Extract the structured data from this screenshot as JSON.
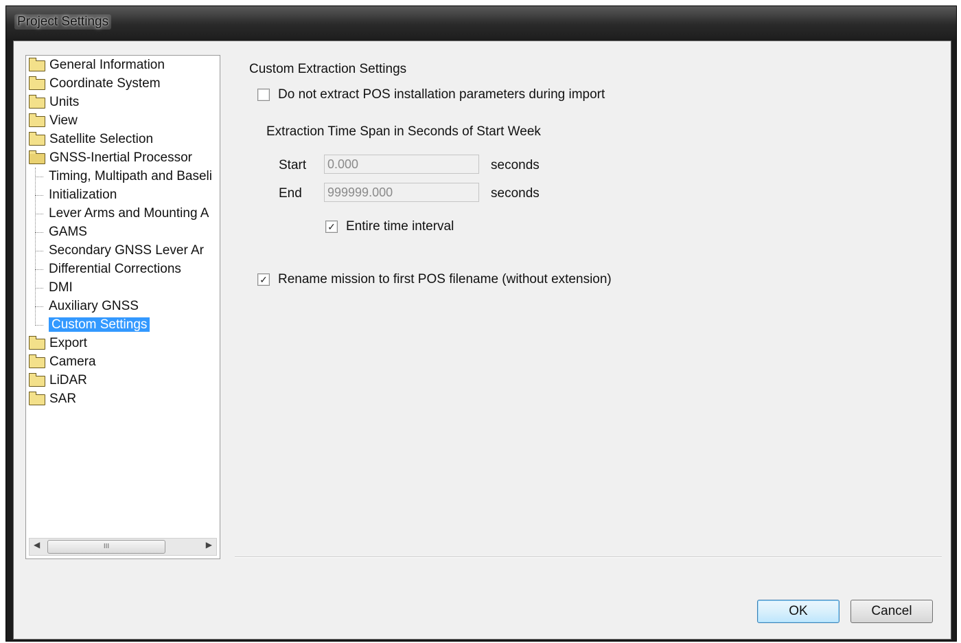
{
  "window": {
    "title": "Project Settings"
  },
  "tree": {
    "items": [
      {
        "label": "General Information",
        "type": "folder"
      },
      {
        "label": "Coordinate System",
        "type": "folder"
      },
      {
        "label": "Units",
        "type": "folder"
      },
      {
        "label": "View",
        "type": "folder"
      },
      {
        "label": "Satellite Selection",
        "type": "folder"
      },
      {
        "label": "GNSS-Inertial Processor",
        "type": "folder-open"
      },
      {
        "label": "Timing, Multipath and Baseli",
        "type": "child"
      },
      {
        "label": "Initialization",
        "type": "child"
      },
      {
        "label": "Lever Arms and Mounting A",
        "type": "child"
      },
      {
        "label": "GAMS",
        "type": "child"
      },
      {
        "label": "Secondary GNSS Lever Ar",
        "type": "child"
      },
      {
        "label": "Differential Corrections",
        "type": "child"
      },
      {
        "label": "DMI",
        "type": "child"
      },
      {
        "label": "Auxiliary GNSS",
        "type": "child"
      },
      {
        "label": "Custom Settings",
        "type": "child",
        "selected": true
      },
      {
        "label": "Export",
        "type": "folder"
      },
      {
        "label": "Camera",
        "type": "folder"
      },
      {
        "label": "LiDAR",
        "type": "folder"
      },
      {
        "label": "SAR",
        "type": "folder"
      }
    ],
    "scroll_thumb_label": "III"
  },
  "panel": {
    "title": "Custom Extraction Settings",
    "no_extract": {
      "label": "Do not extract POS installation parameters during import",
      "checked": false
    },
    "timespan_heading": "Extraction Time Span in Seconds of Start Week",
    "start": {
      "label": "Start",
      "value": "0.000",
      "unit": "seconds"
    },
    "end": {
      "label": "End",
      "value": "999999.000",
      "unit": "seconds"
    },
    "entire_interval": {
      "label": "Entire time interval",
      "checked": true
    },
    "rename": {
      "label": "Rename mission to first POS filename (without extension)",
      "checked": true
    }
  },
  "buttons": {
    "ok": "OK",
    "cancel": "Cancel"
  }
}
